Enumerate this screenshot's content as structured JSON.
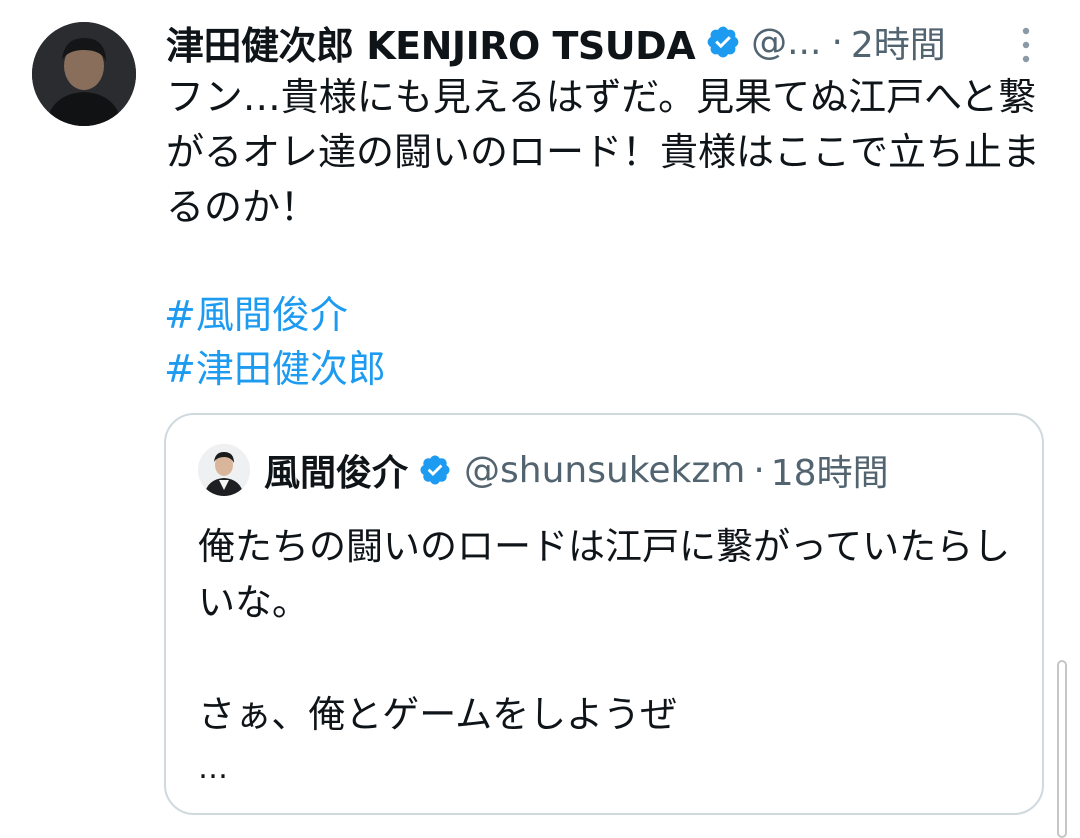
{
  "tweet": {
    "author": {
      "display_name": "津田健次郎 KENJIRO TSUDA",
      "handle": "@...",
      "separator": "·",
      "time": "2時間",
      "avatar_icon": "profile-photo"
    },
    "more_icon": "more-vertical-icon",
    "text": "フン…貴様にも見えるはずだ。見果てぬ江戸へと繋がるオレ達の闘いのロード！貴様はここで立ち止まるのか！",
    "hashtags": [
      "#風間俊介",
      "#津田健次郎"
    ],
    "quote": {
      "author": {
        "display_name": "風間俊介",
        "handle": "@shunsukekzm",
        "separator": "·",
        "time": "18時間",
        "avatar_icon": "profile-photo"
      },
      "text": "俺たちの闘いのロードは江戸に繋がっていたらしいな。\n\nさぁ、俺とゲームをしようぜ",
      "ellipsis": "…"
    }
  },
  "colors": {
    "text_primary": "#0f1419",
    "text_secondary": "#536471",
    "link": "#1d9bf0",
    "verified": "#1d9bf0",
    "card_border": "#cfd9de"
  }
}
